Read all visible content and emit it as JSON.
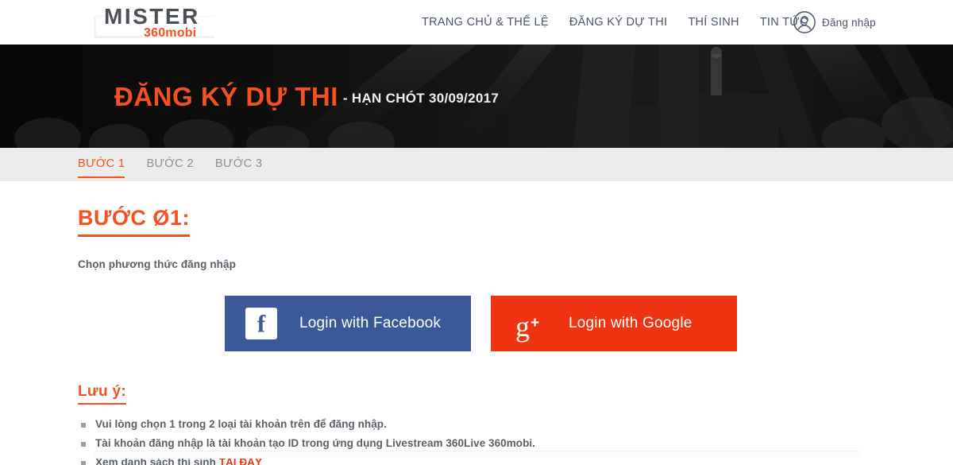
{
  "header": {
    "logo": {
      "primary": "MISTER",
      "secondary": "360mobi"
    },
    "nav": [
      {
        "label": "TRANG CHỦ & THỂ LỆ",
        "name": "nav-item-home-rules"
      },
      {
        "label": "ĐĂNG KÝ DỰ THI",
        "name": "nav-item-register"
      },
      {
        "label": "THÍ SINH",
        "name": "nav-item-contestants"
      },
      {
        "label": "TIN TỨC",
        "name": "nav-item-news"
      }
    ],
    "login": {
      "label": "Đăng nhập",
      "icon": "user-circle-icon"
    }
  },
  "hero": {
    "title": "ĐĂNG KÝ DỰ THI",
    "deadline": "- HẠN CHÓT 30/09/2017"
  },
  "steps": {
    "tabs": [
      {
        "label": "BƯỚC 1",
        "active": true
      },
      {
        "label": "BƯỚC 2",
        "active": false
      },
      {
        "label": "BƯỚC 3",
        "active": false
      }
    ]
  },
  "main": {
    "step_heading": "BƯỚC Ø1:",
    "step_subtitle": "Chọn phương thức đăng nhập",
    "auth": {
      "facebook": {
        "label": "Login with Facebook",
        "icon": "facebook-icon",
        "glyph": "f"
      },
      "google": {
        "label": "Login with Google",
        "icon": "google-plus-icon",
        "glyph": "g",
        "glyph_sup": "+"
      }
    },
    "notes": {
      "heading": "Lưu ý:",
      "items": [
        {
          "text": "Vui lòng chọn 1 trong 2 loại tài khoản trên để đăng nhập.",
          "link": ""
        },
        {
          "text": "Tài khoản đăng nhập là tài khoản tạo ID trong ứng dụng Livestream 360Live 360mobi.",
          "link": ""
        },
        {
          "text": "Xem danh sách thí sinh ",
          "link": "TẠI ĐÂY"
        }
      ]
    }
  },
  "colors": {
    "brand_orange": "#f4511e",
    "facebook_blue": "#3b5998",
    "google_red": "#f03311",
    "nav_text": "#4a5568",
    "tab_bar_bg": "#ececec",
    "body_text": "#5a6068"
  }
}
